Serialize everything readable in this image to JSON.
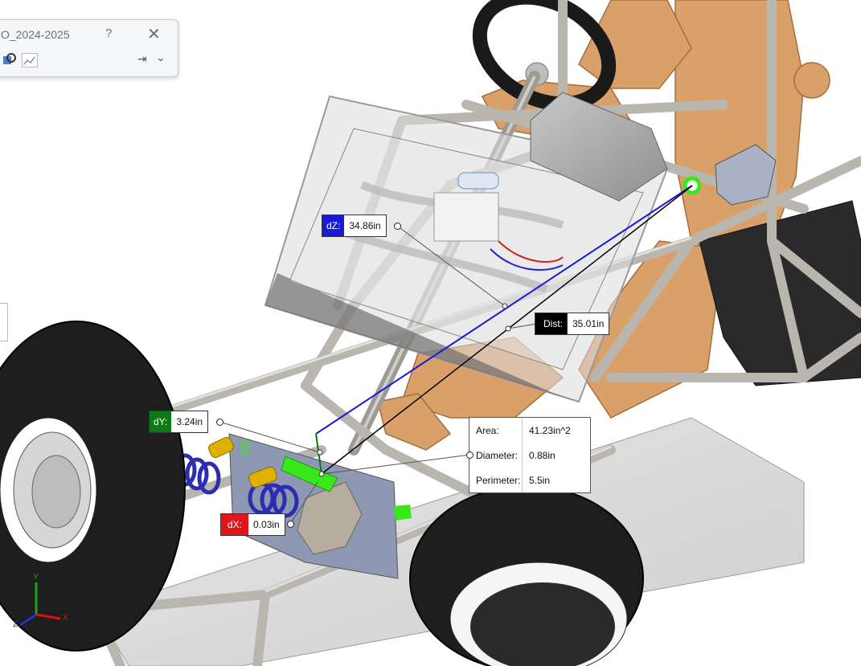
{
  "dialog": {
    "title": "O_2024-2025",
    "help_glyph": "?",
    "close_glyph": "✕",
    "pin_glyph": "⇥",
    "chevron_glyph": "⌄",
    "icons": [
      "measure-probe-icon",
      "graph-icon",
      "pin-icon",
      "chevron-down-icon"
    ]
  },
  "measurements": {
    "dz": {
      "label": "dZ:",
      "value": "34.86in",
      "color": "#1a1ad6"
    },
    "dist": {
      "label": "Dist:",
      "value": "35.01in",
      "color": "#000000"
    },
    "dy": {
      "label": "dY:",
      "value": "3.24in",
      "color": "#0b7a12"
    },
    "dx": {
      "label": "dX:",
      "value": "0.03in",
      "color": "#e3131b"
    }
  },
  "face_info": {
    "area_label": "Area:",
    "area_value": "41.23in^2",
    "diameter_label": "Diameter:",
    "diameter_value": "0.88in",
    "perimeter_label": "Perimeter:",
    "perimeter_value": "5.5in"
  },
  "triad": {
    "x_label": "X",
    "y_label": "Y",
    "z_label": "Z"
  },
  "colors": {
    "frame_tube": "#b9b6b0",
    "tire": "#1e1e1e",
    "mannequin": "#d9a06a",
    "spring": "#2d2db0",
    "highlight": "#39e81a"
  }
}
